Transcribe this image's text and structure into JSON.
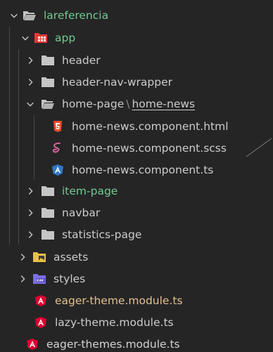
{
  "explorer": {
    "colors": {
      "background": "#252526",
      "text": "#cccccc",
      "modified_green": "#73c991",
      "modified_orange": "#e2c08d",
      "folder": "#c5c5c5",
      "html_icon": "#e44d26",
      "scss_icon": "#cd6799",
      "angular_icon": "#dd0031",
      "typescript_icon": "#3178c6",
      "assets_icon": "#e8c14a",
      "css_icon": "#7b6fe3"
    },
    "items": [
      {
        "name": "lareferencia",
        "expanded": true,
        "icon": "folder-open-icon",
        "color": "green"
      },
      {
        "name": "app",
        "expanded": true,
        "icon": "app-folder-icon",
        "color": "green"
      },
      {
        "name": "header",
        "expanded": false,
        "icon": "folder-icon",
        "color": "default"
      },
      {
        "name": "header-nav-wrapper",
        "expanded": false,
        "icon": "folder-icon",
        "color": "default"
      },
      {
        "name": "home-page",
        "separator": "\\",
        "name2": "home-news",
        "expanded": true,
        "icon": "folder-open-icon",
        "color": "default"
      },
      {
        "name": "home-news.component.html",
        "icon": "html5-icon",
        "color": "default"
      },
      {
        "name": "home-news.component.scss",
        "icon": "sass-icon",
        "color": "default"
      },
      {
        "name": "home-news.component.ts",
        "icon": "angular-ts-icon",
        "color": "default"
      },
      {
        "name": "item-page",
        "expanded": false,
        "icon": "folder-icon",
        "color": "green"
      },
      {
        "name": "navbar",
        "expanded": false,
        "icon": "folder-icon",
        "color": "default"
      },
      {
        "name": "statistics-page",
        "expanded": false,
        "icon": "folder-icon",
        "color": "default"
      },
      {
        "name": "assets",
        "expanded": false,
        "icon": "assets-folder-icon",
        "color": "default"
      },
      {
        "name": "styles",
        "expanded": false,
        "icon": "css-folder-icon",
        "color": "default"
      },
      {
        "name": "eager-theme.module.ts",
        "icon": "angular-icon",
        "color": "orange"
      },
      {
        "name": "lazy-theme.module.ts",
        "icon": "angular-icon",
        "color": "default"
      },
      {
        "name": "eager-themes.module.ts",
        "icon": "angular-icon",
        "color": "default"
      }
    ]
  }
}
